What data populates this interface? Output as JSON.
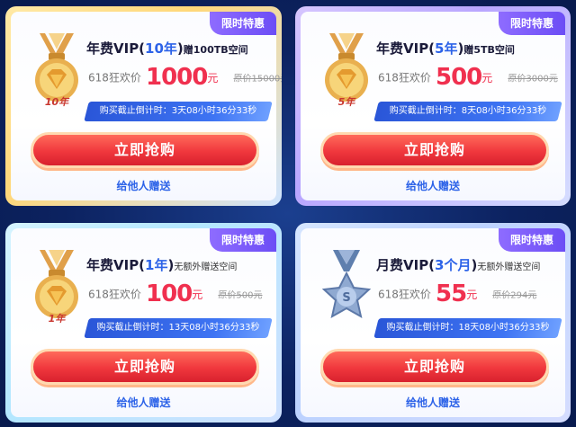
{
  "cards": [
    {
      "badge": "限时特惠",
      "title_pre": "年费VIP(",
      "title_num": "10年",
      "title_post": ")",
      "title_extra_pre": "赠",
      "title_extra_num": "100",
      "title_extra_post": "TB空间",
      "price_label": "618狂欢价",
      "price": "1000",
      "yuan": "元",
      "original": "原价15000元",
      "countdown": "购买截止倒计时：3天08小时36分33秒",
      "buy_label": "立即抢购",
      "gift_label": "给他人赠送",
      "medal_text": "10年",
      "medal_icon": "gold-medal-icon"
    },
    {
      "badge": "限时特惠",
      "title_pre": "年费VIP(",
      "title_num": "5年",
      "title_post": ")",
      "title_extra_pre": "赠",
      "title_extra_num": "5",
      "title_extra_post": "TB空间",
      "price_label": "618狂欢价",
      "price": "500",
      "yuan": "元",
      "original": "原价3000元",
      "countdown": "购买截止倒计时：8天08小时36分33秒",
      "buy_label": "立即抢购",
      "gift_label": "给他人赠送",
      "medal_text": "5年",
      "medal_icon": "gold-medal-icon"
    },
    {
      "badge": "限时特惠",
      "title_pre": "年费VIP(",
      "title_num": "1年",
      "title_post": ")",
      "title_extra": "无额外赠送空间",
      "price_label": "618狂欢价",
      "price": "100",
      "yuan": "元",
      "original": "原价500元",
      "countdown": "购买截止倒计时：13天08小时36分33秒",
      "buy_label": "立即抢购",
      "gift_label": "给他人赠送",
      "medal_text": "1年",
      "medal_icon": "gold-medal-icon"
    },
    {
      "badge": "限时特惠",
      "title_pre": "月费VIP(",
      "title_num": "3个月",
      "title_post": ")",
      "title_extra": "无额外赠送空间",
      "price_label": "618狂欢价",
      "price": "55",
      "yuan": "元",
      "original": "原价294元",
      "countdown": "购买截止倒计时：18天08小时36分33秒",
      "buy_label": "立即抢购",
      "gift_label": "给他人赠送",
      "medal_text": "",
      "medal_icon": "silver-star-medal-icon"
    }
  ],
  "colors": {
    "accent_blue": "#2d63e8",
    "price_red": "#f0304f",
    "badge_purple": "#7a5cff",
    "button_red": "#f0373d"
  }
}
